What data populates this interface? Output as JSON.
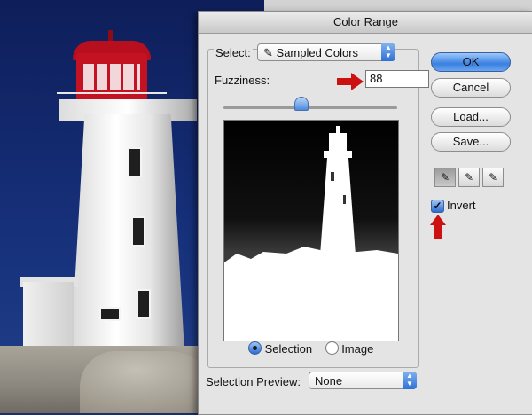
{
  "dialog": {
    "title": "Color Range",
    "select_label": "Select:",
    "select_value": "Sampled Colors",
    "fuzziness_label": "Fuzziness:",
    "fuzziness_value": "88",
    "fuzziness_level": 0.44,
    "preview_options": {
      "selection": "Selection",
      "image": "Image",
      "selected": "selection"
    },
    "selection_preview_label": "Selection Preview:",
    "selection_preview_value": "None",
    "buttons": {
      "ok": "OK",
      "cancel": "Cancel",
      "load": "Load...",
      "save": "Save..."
    },
    "invert_label": "Invert",
    "invert_checked": true,
    "eyedroppers": [
      "eyedropper-icon",
      "eyedropper-plus-icon",
      "eyedropper-minus-icon"
    ]
  },
  "colors": {
    "annotation_arrow": "#cc1111",
    "default_button": "#3a80e0",
    "lighthouse_red": "#c41222"
  }
}
